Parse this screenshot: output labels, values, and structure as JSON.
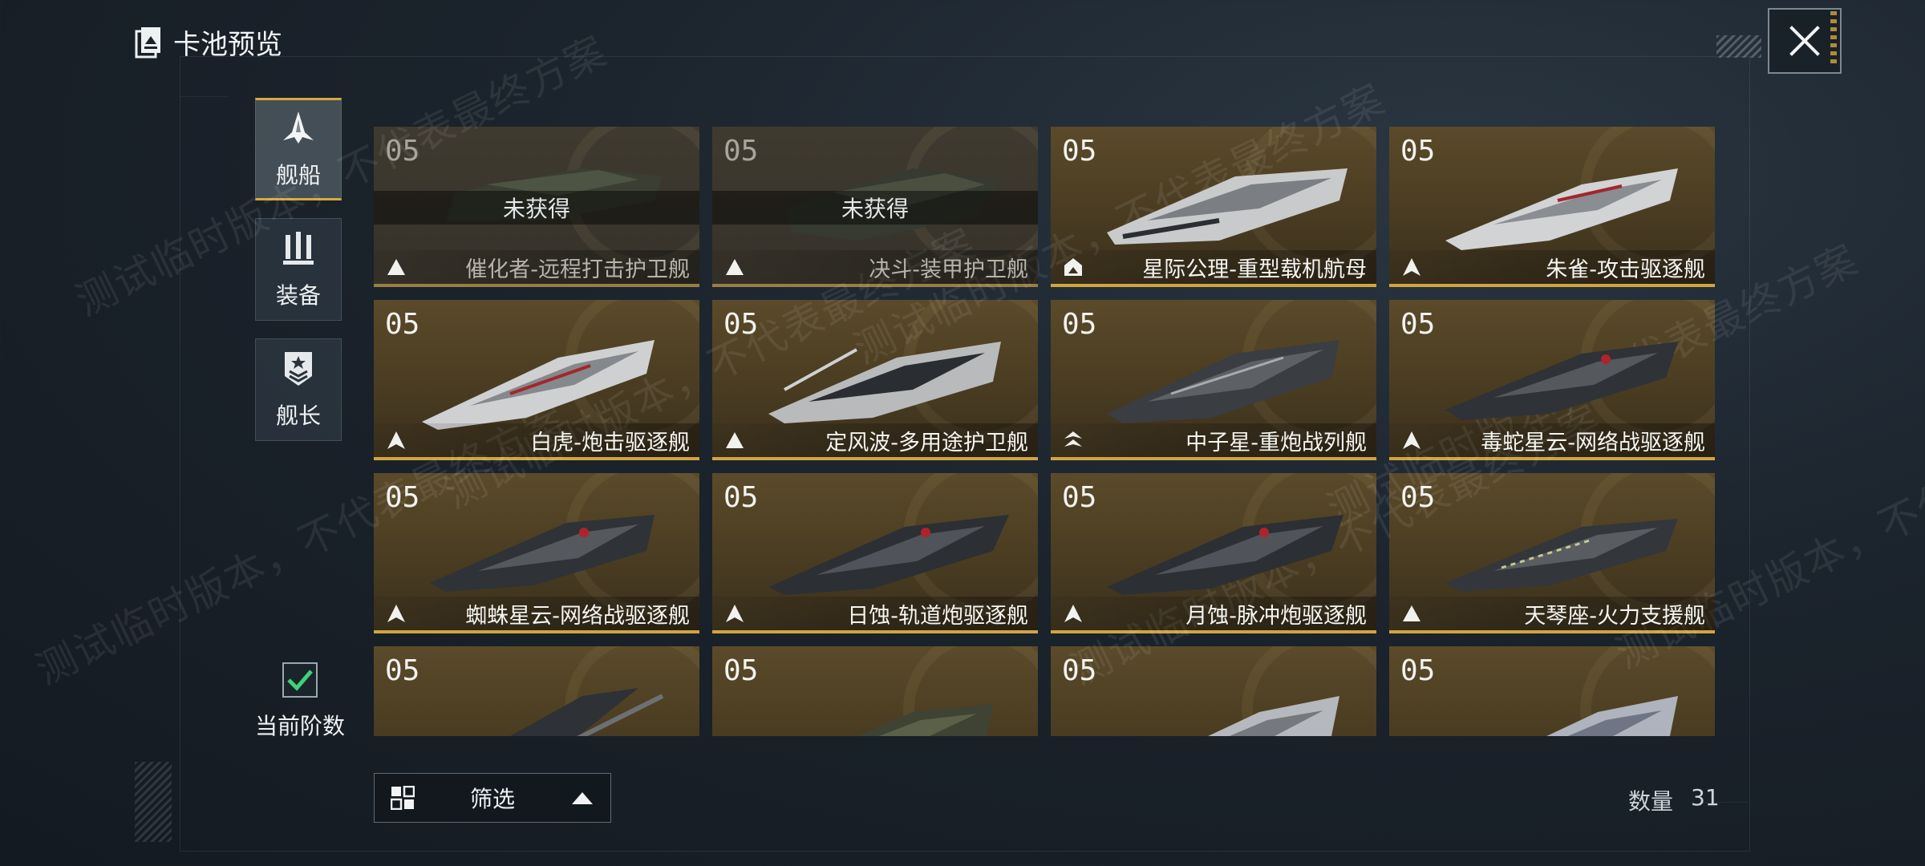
{
  "header": {
    "title": "卡池预览"
  },
  "close": {
    "icon": "close-icon"
  },
  "side_tabs": [
    {
      "label": "舰船",
      "icon": "ship-icon",
      "active": true
    },
    {
      "label": "装备",
      "icon": "equipment-icon",
      "active": false
    },
    {
      "label": "舰长",
      "icon": "captain-icon",
      "active": false
    }
  ],
  "current_tier": {
    "label": "当前阶数",
    "checked": true
  },
  "cards": [
    {
      "tier": "05",
      "name": "催化者-远程打击护卫舰",
      "locked_text": "未获得",
      "class_icon": "frigate-icon"
    },
    {
      "tier": "05",
      "name": "决斗-装甲护卫舰",
      "locked_text": "未获得",
      "class_icon": "frigate-icon"
    },
    {
      "tier": "05",
      "name": "星际公理-重型载机航母",
      "locked_text": "",
      "class_icon": "carrier-icon"
    },
    {
      "tier": "05",
      "name": "朱雀-攻击驱逐舰",
      "locked_text": "",
      "class_icon": "destroyer-icon"
    },
    {
      "tier": "05",
      "name": "白虎-炮击驱逐舰",
      "locked_text": "",
      "class_icon": "destroyer-icon"
    },
    {
      "tier": "05",
      "name": "定风波-多用途护卫舰",
      "locked_text": "",
      "class_icon": "frigate-icon"
    },
    {
      "tier": "05",
      "name": "中子星-重炮战列舰",
      "locked_text": "",
      "class_icon": "battleship-icon"
    },
    {
      "tier": "05",
      "name": "毒蛇星云-网络战驱逐舰",
      "locked_text": "",
      "class_icon": "destroyer-icon"
    },
    {
      "tier": "05",
      "name": "蜘蛛星云-网络战驱逐舰",
      "locked_text": "",
      "class_icon": "destroyer-icon"
    },
    {
      "tier": "05",
      "name": "日蚀-轨道炮驱逐舰",
      "locked_text": "",
      "class_icon": "destroyer-icon"
    },
    {
      "tier": "05",
      "name": "月蚀-脉冲炮驱逐舰",
      "locked_text": "",
      "class_icon": "destroyer-icon"
    },
    {
      "tier": "05",
      "name": "天琴座-火力支援舰",
      "locked_text": "",
      "class_icon": "frigate-icon"
    },
    {
      "tier": "05",
      "name": "",
      "locked_text": "",
      "class_icon": ""
    },
    {
      "tier": "05",
      "name": "",
      "locked_text": "",
      "class_icon": ""
    },
    {
      "tier": "05",
      "name": "",
      "locked_text": "",
      "class_icon": ""
    },
    {
      "tier": "05",
      "name": "",
      "locked_text": "",
      "class_icon": ""
    }
  ],
  "filter": {
    "label": "筛选",
    "icon": "grid-icon",
    "caret_icon": "caret-up-icon"
  },
  "count": {
    "label": "数量",
    "value": "31"
  },
  "watermark": {
    "text": "测试临时版本，不代表最终方案"
  },
  "colors": {
    "accent": "#d2a440",
    "card_bg": "#4a3c22",
    "bg": "#1b232c"
  }
}
